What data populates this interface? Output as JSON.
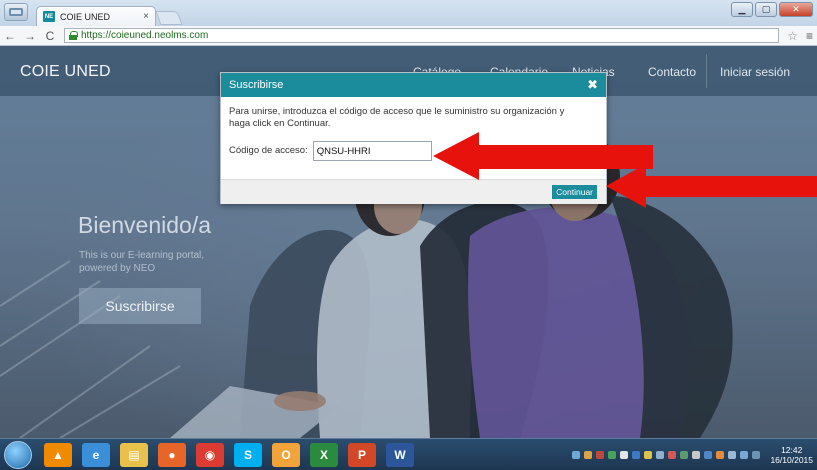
{
  "browser": {
    "tab_title": "COIE UNED",
    "tab_favicon": "NE",
    "tab_close": "×",
    "url": "https://coieuned.neolms.com"
  },
  "site": {
    "brand": "COIE UNED",
    "nav": [
      "Catálogo",
      "Calendario",
      "Noticias",
      "Contacto",
      "Iniciar sesión"
    ],
    "hero_title": "Bienvenido/a",
    "hero_sub_line1": "This is our E-learning portal,",
    "hero_sub_line2": "powered by NEO",
    "hero_button": "Suscribirse"
  },
  "modal": {
    "title": "Suscribirse",
    "close": "✖",
    "instructions": "Para unirse, introduzca el código de acceso que le suministro su organización y haga click en Continuar.",
    "field_label": "Código de acceso:",
    "field_value": "QNSU-HHRI",
    "continue_label": "Continuar"
  },
  "taskbar": {
    "clock_time": "12:42",
    "clock_date": "16/10/2015",
    "apps": [
      {
        "name": "vlc-icon",
        "glyph": "▲",
        "color": "#f08a00"
      },
      {
        "name": "internet-explorer-icon",
        "glyph": "e",
        "color": "#3a8fd8"
      },
      {
        "name": "file-explorer-icon",
        "glyph": "▤",
        "color": "#e9c04a"
      },
      {
        "name": "firefox-icon",
        "glyph": "●",
        "color": "#e8652a"
      },
      {
        "name": "chrome-icon",
        "glyph": "◉",
        "color": "#dc3b32"
      },
      {
        "name": "skype-icon",
        "glyph": "S",
        "color": "#00aff0"
      },
      {
        "name": "outlook-icon",
        "glyph": "O",
        "color": "#f2a33a"
      },
      {
        "name": "excel-icon",
        "glyph": "X",
        "color": "#2a8a3e"
      },
      {
        "name": "powerpoint-icon",
        "glyph": "P",
        "color": "#d24726"
      },
      {
        "name": "word-icon",
        "glyph": "W",
        "color": "#2b579a"
      }
    ]
  },
  "colors": {
    "accent": "#1a8c9c",
    "arrow": "#e8120c"
  }
}
